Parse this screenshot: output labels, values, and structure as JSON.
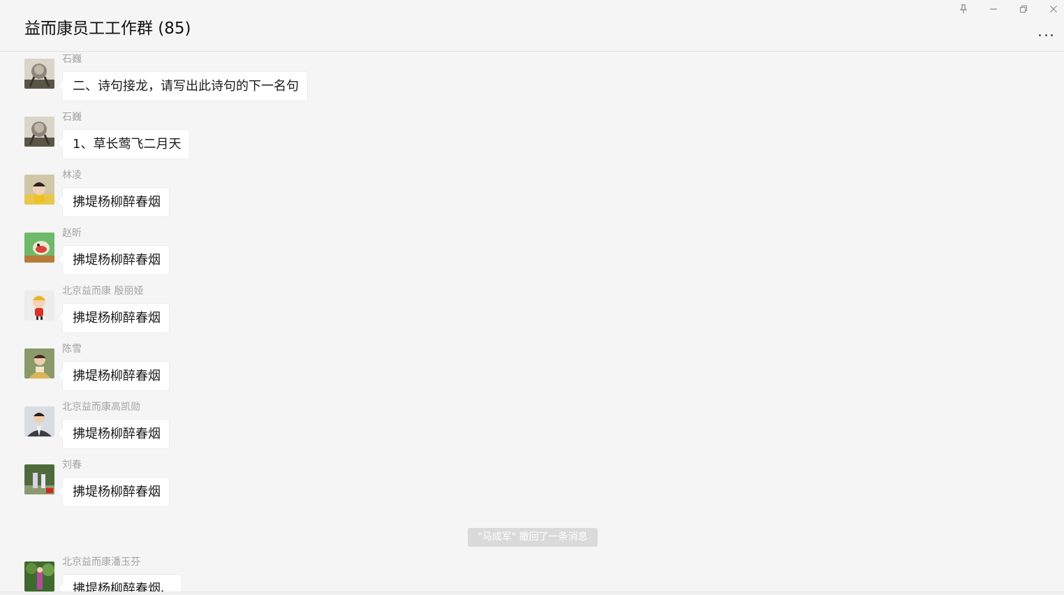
{
  "chat": {
    "title": "益而康员工工作群 (85)"
  },
  "window_controls": [
    {
      "name": "pin-icon",
      "glyph": "⊥"
    },
    {
      "name": "minimize-icon",
      "glyph": "—"
    },
    {
      "name": "restore-icon",
      "glyph": "❐"
    },
    {
      "name": "close-icon",
      "glyph": "✕"
    }
  ],
  "messages": [
    {
      "sender": "石巍",
      "text": "二、诗句接龙，请写出此诗句的下一名句",
      "avatar": "wolf-avatar"
    },
    {
      "sender": "石巍",
      "text": "1、草长莺飞二月天",
      "avatar": "wolf-avatar"
    },
    {
      "sender": "林凌",
      "text": "拂堤杨柳醉春烟",
      "avatar": "child-avatar"
    },
    {
      "sender": "赵昕",
      "text": "拂堤杨柳醉春烟",
      "avatar": "cartoon-avatar"
    },
    {
      "sender": "北京益而康 殷丽娅",
      "text": "拂堤杨柳醉春烟",
      "avatar": "cartoon-girl-avatar"
    },
    {
      "sender": "陈雪",
      "text": "拂堤杨柳醉春烟",
      "avatar": "painting-avatar"
    },
    {
      "sender": "北京益而康高凯勋",
      "text": "拂堤杨柳醉春烟",
      "avatar": "suit-man-avatar"
    },
    {
      "sender": "刘春",
      "text": "拂堤杨柳醉春烟",
      "avatar": "outdoor-avatar"
    },
    {
      "sender": "北京益而康潘玉芬",
      "text": "拂堤杨柳醉春烟、",
      "avatar": "garden-avatar"
    }
  ],
  "system_notice": "\"马成军\" 撤回了一条消息"
}
